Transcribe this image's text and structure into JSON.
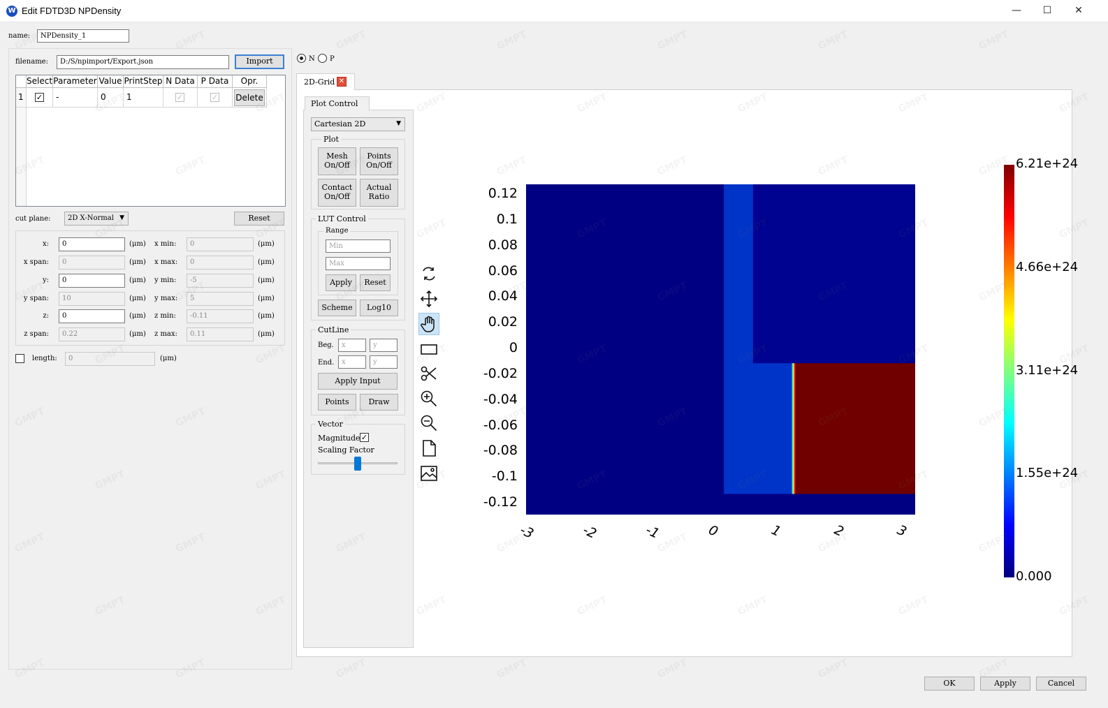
{
  "window": {
    "title": "Edit FDTD3D NPDensity",
    "icon": "app-logo-icon",
    "minimize": "—",
    "maximize": "☐",
    "close": "✕"
  },
  "name_row": {
    "label": "name:",
    "value": "NPDensity_1"
  },
  "file_row": {
    "label": "filename:",
    "value": "D:/S/npimport/Export.json",
    "import_label": "Import"
  },
  "polarity": {
    "options": [
      "N",
      "P"
    ],
    "selected": "N"
  },
  "table": {
    "columns": [
      "Select",
      "Parameter",
      "Value",
      "PrintStep",
      "N Data",
      "P Data",
      "Opr."
    ],
    "rows": [
      {
        "index": "1",
        "select": true,
        "parameter": "-",
        "value": "0",
        "printstep": "1",
        "n_data": true,
        "p_data": true,
        "opr": "Delete"
      }
    ]
  },
  "cut_plane": {
    "label": "cut plane:",
    "value": "2D X-Normal",
    "reset_label": "Reset"
  },
  "geometry": {
    "unit": "(μm)",
    "x": {
      "label": "x:",
      "value": "0"
    },
    "x_span": {
      "label": "x span:",
      "value": "0"
    },
    "y": {
      "label": "y:",
      "value": "0"
    },
    "y_span": {
      "label": "y span:",
      "value": "10"
    },
    "z": {
      "label": "z:",
      "value": "0"
    },
    "z_span": {
      "label": "z span:",
      "value": "0.22"
    },
    "x_min": {
      "label": "x min:",
      "value": "0"
    },
    "x_max": {
      "label": "x max:",
      "value": "0"
    },
    "y_min": {
      "label": "y min:",
      "value": "-5"
    },
    "y_max": {
      "label": "y max:",
      "value": "5"
    },
    "z_min": {
      "label": "z min:",
      "value": "-0.11"
    },
    "z_max": {
      "label": "z max:",
      "value": "0.11"
    }
  },
  "length": {
    "label": "length:",
    "value": "0",
    "unit": "(μm)",
    "checked": false
  },
  "tab": {
    "label": "2D-Grid"
  },
  "plot_control": {
    "tab_label": "Plot Control",
    "mode": "Cartesian 2D",
    "plot_group": "Plot",
    "mesh_btn": [
      "Mesh",
      "On/Off"
    ],
    "points_btn": [
      "Points",
      "On/Off"
    ],
    "contact_btn": [
      "Contact",
      "On/Off"
    ],
    "actual_btn": [
      "Actual",
      "Ratio"
    ],
    "lut_group": "LUT Control",
    "range_group": "Range",
    "min_placeholder": "Min",
    "max_placeholder": "Max",
    "apply_label": "Apply",
    "reset_label": "Reset",
    "scheme_label": "Scheme",
    "log_label": "Log10",
    "cutline_group": "CutLine",
    "beg_label": "Beg.",
    "end_label": "End.",
    "x_placeholder": "x",
    "y_placeholder": "y",
    "apply_input_label": "Apply Input",
    "points_label": "Points",
    "draw_label": "Draw",
    "vector_group": "Vector",
    "magnitude_label": "Magnitude",
    "magnitude_checked": true,
    "scaling_label": "Scaling Factor",
    "scaling_value": 0.5
  },
  "toolbar": [
    "rotate-icon",
    "pan-arrows-icon",
    "hand-icon",
    "rectangle-select-icon",
    "scissors-icon",
    "zoom-in-icon",
    "zoom-out-icon",
    "page-icon",
    "save-image-icon"
  ],
  "chart_data": {
    "type": "heatmap",
    "x_ticks": [
      "-3",
      "-2",
      "-1",
      "0",
      "1",
      "2",
      "3"
    ],
    "y_ticks": [
      "0.12",
      "0.1",
      "0.08",
      "0.06",
      "0.04",
      "0.02",
      "0",
      "-0.02",
      "-0.04",
      "-0.06",
      "-0.08",
      "-0.1",
      "-0.12"
    ],
    "xlim": [
      -3,
      3
    ],
    "ylim": [
      -0.12,
      0.12
    ],
    "colorbar_ticks": [
      "6.21e+24",
      "4.66e+24",
      "3.11e+24",
      "1.55e+24",
      "0.000"
    ],
    "colorbar_range": [
      0,
      6.21e+24
    ],
    "regions": [
      {
        "x0": -3,
        "x1": 3,
        "y0": -0.12,
        "y1": 0.12,
        "value": 0,
        "color": "#000083"
      },
      {
        "x0": 0.05,
        "x1": 1.15,
        "y0": -0.105,
        "y1": 0.12,
        "value": 3.5e+23,
        "color": "#0033c8"
      },
      {
        "x0": 0.5,
        "x1": 3,
        "y0": -0.01,
        "y1": 0.12,
        "value": 0,
        "color": "#00038f"
      },
      {
        "x0": 1.15,
        "x1": 3,
        "y0": -0.105,
        "y1": -0.01,
        "value": 6.21e+24,
        "color": "#700000"
      }
    ],
    "colormap": "jet"
  },
  "footer": {
    "ok_label": "OK",
    "apply_label": "Apply",
    "cancel_label": "Cancel"
  },
  "watermark": "GMPT"
}
